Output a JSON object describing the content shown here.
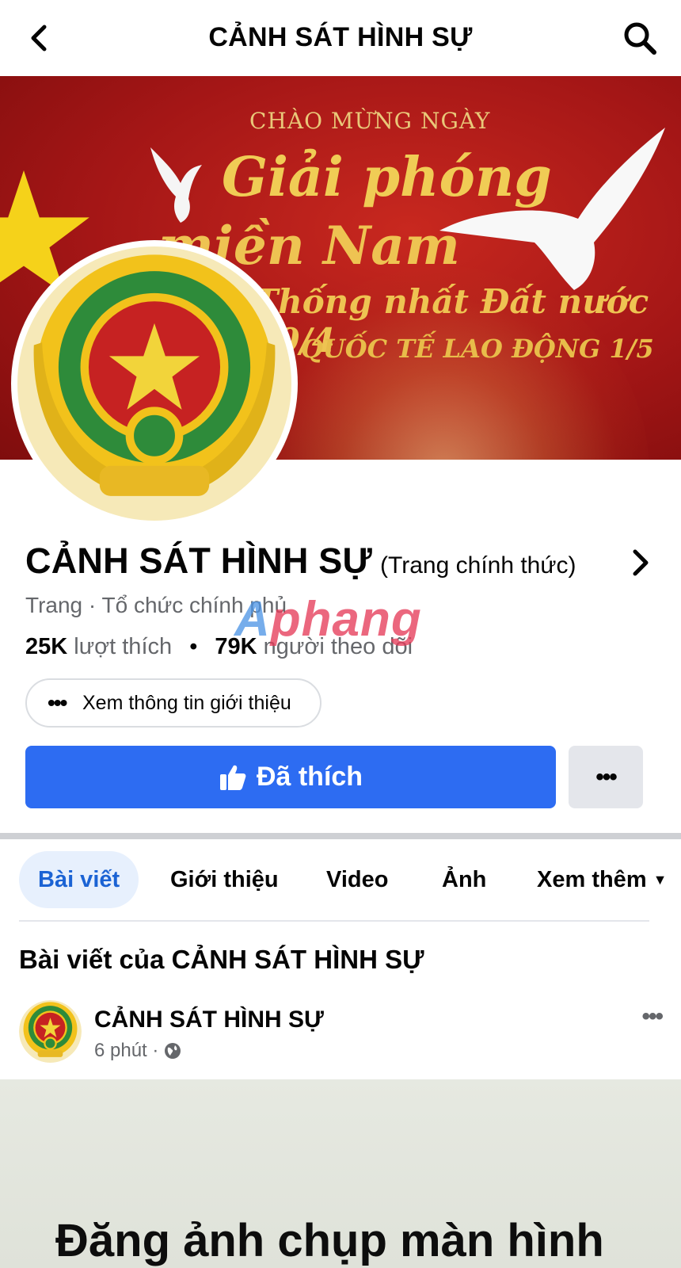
{
  "topbar": {
    "title": "CẢNH SÁT HÌNH SỰ"
  },
  "cover": {
    "line1": "CHÀO MỪNG NGÀY",
    "line2": "Giải phóng",
    "line3": "miền Nam",
    "line4": "Thống nhất Đất nước 30/4",
    "line5": "QUỐC TẾ LAO ĐỘNG 1/5"
  },
  "page": {
    "name": "CẢNH SÁT HÌNH SỰ",
    "subtitle": "(Trang chính thức)",
    "category": "Trang · Tổ chức chính phủ",
    "likes_count": "25K",
    "likes_label": "lượt thích",
    "separator": "•",
    "followers_count": "79K",
    "followers_label": "người theo dõi",
    "watermark_a": "A",
    "watermark_rest": "phang"
  },
  "actions": {
    "intro_label": "Xem thông tin giới thiệu",
    "liked_label": "Đã thích",
    "more_label": "•••"
  },
  "tabs": [
    {
      "label": "Bài viết",
      "active": true
    },
    {
      "label": "Giới thiệu",
      "active": false
    },
    {
      "label": "Video",
      "active": false
    },
    {
      "label": "Ảnh",
      "active": false
    },
    {
      "label": "Xem thêm",
      "active": false
    }
  ],
  "posts": {
    "heading": "Bài viết của CẢNH SÁT HÌNH SỰ",
    "first": {
      "author": "CẢNH SÁT HÌNH SỰ",
      "time": "6 phút ·",
      "more": "•••",
      "media_text": "Đăng ảnh chụp màn hình"
    }
  },
  "colors": {
    "primary_blue": "#2d6cf2",
    "tab_active_bg": "#e7f0fd",
    "tab_active_text": "#1b63d4",
    "secondary_text": "#65676b",
    "cover_red": "#a41616",
    "emblem_gold": "#f2c21b",
    "emblem_green": "#2e8b3a"
  }
}
